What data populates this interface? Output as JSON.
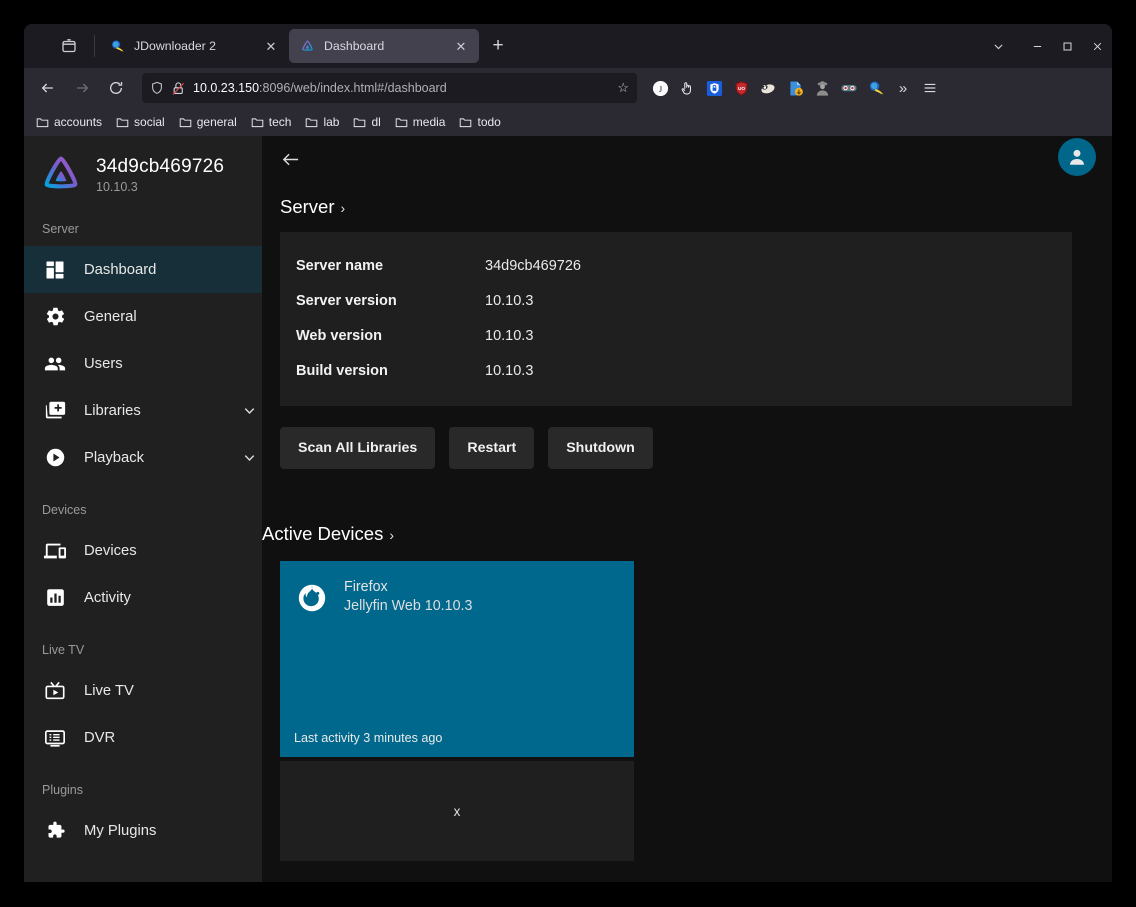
{
  "browser": {
    "list_all_tabs_icon": "list-all-tabs-icon",
    "tabs": [
      {
        "title": "JDownloader 2",
        "favicon": "jdownloader-favicon",
        "active": false,
        "close_label": "✕"
      },
      {
        "title": "Dashboard",
        "favicon": "jellyfin-favicon",
        "active": true,
        "close_label": "✕"
      }
    ],
    "new_tab_label": "+",
    "tab_list_chevron": "⌄",
    "window_controls": {
      "minimize": "—",
      "maximize": "☐",
      "close": "✕"
    },
    "nav": {
      "back_label": "←",
      "forward_label": "→",
      "reload_label": "⟳"
    },
    "url": {
      "host": "10.0.23.150",
      "path": ":8096/web/index.html#/dashboard",
      "shield_icon": "shield-icon",
      "tracking_icon": "tracking-protection-off-icon",
      "bookmark_star": "☆"
    },
    "extensions": [
      "j-circle-extension-icon",
      "hand-cursor-extension-icon",
      "bitwarden-extension-icon",
      "ublock-origin-extension-icon",
      "badger-extension-icon",
      "download-helper-extension-icon",
      "spy-extension-icon",
      "goggles-extension-icon",
      "jdownloader-extension-icon"
    ],
    "overflow_label": "»",
    "menu_label": "☰",
    "bookmarks": [
      {
        "label": "accounts"
      },
      {
        "label": "social"
      },
      {
        "label": "general"
      },
      {
        "label": "tech"
      },
      {
        "label": "lab"
      },
      {
        "label": "dl"
      },
      {
        "label": "media"
      },
      {
        "label": "todo"
      }
    ]
  },
  "sidebar": {
    "server_name": "34d9cb469726",
    "server_version": "10.10.3",
    "logo_icon": "jellyfin-logo-icon",
    "sections": [
      {
        "title": "Server",
        "items": [
          {
            "label": "Dashboard",
            "icon": "dashboard-icon",
            "active": true,
            "expandable": false
          },
          {
            "label": "General",
            "icon": "gear-icon",
            "active": false,
            "expandable": false
          },
          {
            "label": "Users",
            "icon": "users-icon",
            "active": false,
            "expandable": false
          },
          {
            "label": "Libraries",
            "icon": "library-add-icon",
            "active": false,
            "expandable": true
          },
          {
            "label": "Playback",
            "icon": "play-circle-icon",
            "active": false,
            "expandable": true
          }
        ]
      },
      {
        "title": "Devices",
        "items": [
          {
            "label": "Devices",
            "icon": "devices-icon",
            "active": false,
            "expandable": false
          },
          {
            "label": "Activity",
            "icon": "activity-chart-icon",
            "active": false,
            "expandable": false
          }
        ]
      },
      {
        "title": "Live TV",
        "items": [
          {
            "label": "Live TV",
            "icon": "live-tv-icon",
            "active": false,
            "expandable": false
          },
          {
            "label": "DVR",
            "icon": "dvr-icon",
            "active": false,
            "expandable": false
          }
        ]
      },
      {
        "title": "Plugins",
        "items": [
          {
            "label": "My Plugins",
            "icon": "puzzle-piece-icon",
            "active": false,
            "expandable": false
          }
        ]
      }
    ],
    "expand_chevron": "⌄"
  },
  "main": {
    "back_label": "←",
    "avatar_icon": "user-avatar-icon",
    "server_section": {
      "title": "Server",
      "chevron": "›",
      "rows": [
        {
          "key": "Server name",
          "value": "34d9cb469726"
        },
        {
          "key": "Server version",
          "value": "10.10.3"
        },
        {
          "key": "Web version",
          "value": "10.10.3"
        },
        {
          "key": "Build version",
          "value": "10.10.3"
        }
      ]
    },
    "buttons": [
      {
        "label": "Scan All Libraries"
      },
      {
        "label": "Restart"
      },
      {
        "label": "Shutdown"
      }
    ],
    "devices_section": {
      "title": "Active Devices",
      "chevron": "›",
      "cards": [
        {
          "icon": "firefox-icon",
          "name": "Firefox",
          "subtitle": "Jellyfin Web 10.10.3",
          "footer": "Last activity 3 minutes ago"
        }
      ],
      "placeholder_text": "x"
    }
  },
  "colors": {
    "accent_teal": "#00688d",
    "sidebar_active": "#172f38",
    "sidebar_bg": "#202020",
    "main_bg": "#101010",
    "card_bg": "#1f1f1f",
    "browser_chrome": "#2b2a33"
  }
}
